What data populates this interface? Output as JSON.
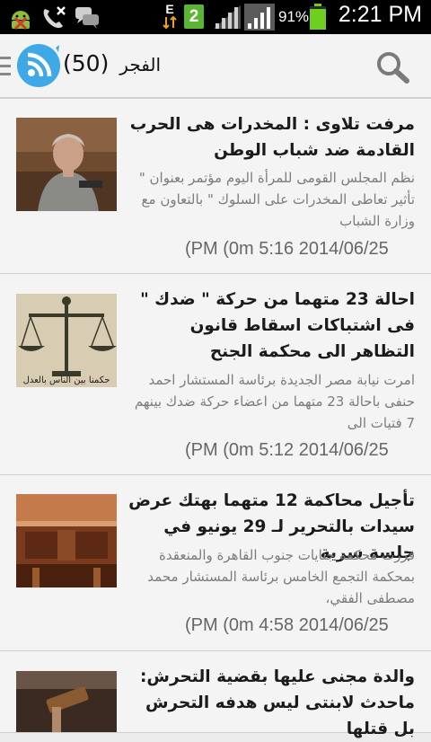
{
  "status_bar": {
    "time": "2:21 PM",
    "battery_percent": "91%",
    "network_type": "E",
    "sim_badge": "2",
    "icons": [
      "android-debug-icon",
      "missed-call-icon",
      "chat-icon",
      "data-transfer-icon",
      "sim2-icon",
      "signal-icon",
      "signal-icon",
      "battery-icon"
    ]
  },
  "action_bar": {
    "title": "الفجر",
    "count": "(50)",
    "logo_icon": "rss-feed-icon",
    "search_icon": "search-icon",
    "menu_icon": "drawer-menu-icon",
    "accent_color": "#3fa9e8"
  },
  "feed": {
    "items": [
      {
        "title": "مرفت تلاوى : المخدرات هى الحرب القادمة ضد شباب الوطن",
        "summary": "نظم المجلس القومى للمرأة اليوم مؤتمر بعنوان \" تأثير تعاطى المخدرات على السلوك \" بالتعاون مع وزارة الشباب",
        "date": "(PM (0m 5:16 2014/06/25",
        "thumbnail": "woman-speaker-photo"
      },
      {
        "title": "احالة 23 متهما من حركة \" ضدك \" فى اشتباكات اسقاط قانون التظاهر الى محكمة الجنح",
        "summary": "امرت نيابة مصر الجديدة برئاسة المستشار احمد حنفى باحالة 23 متهما من اعضاء حركة ضدك بينهم 7 فتيات الى",
        "date": "(PM (0m 5:12 2014/06/25",
        "thumbnail": "scales-of-justice-photo",
        "thumbnail_caption": "حكمنا بين الناس بالعدل"
      },
      {
        "title": "تأجيل محاكمة 12 متهما بهتك عرض سيدات بالتحرير لـ 29 يونيو في جلسة سرية",
        "summary": "قررت محكمة جنايات جنوب القاهرة والمنعقدة بمحكمة التجمع الخامس برئاسة المستشار محمد مصطفى الفقي،",
        "date": "(PM (0m 4:58 2014/06/25",
        "thumbnail": "courtroom-photo"
      },
      {
        "title": "والدة مجنى عليها بقضية التحرش: ماحدث لابنتى ليس هدفه التحرش بل قتلها",
        "summary": "",
        "date": "",
        "thumbnail": "gavel-photo"
      }
    ]
  }
}
